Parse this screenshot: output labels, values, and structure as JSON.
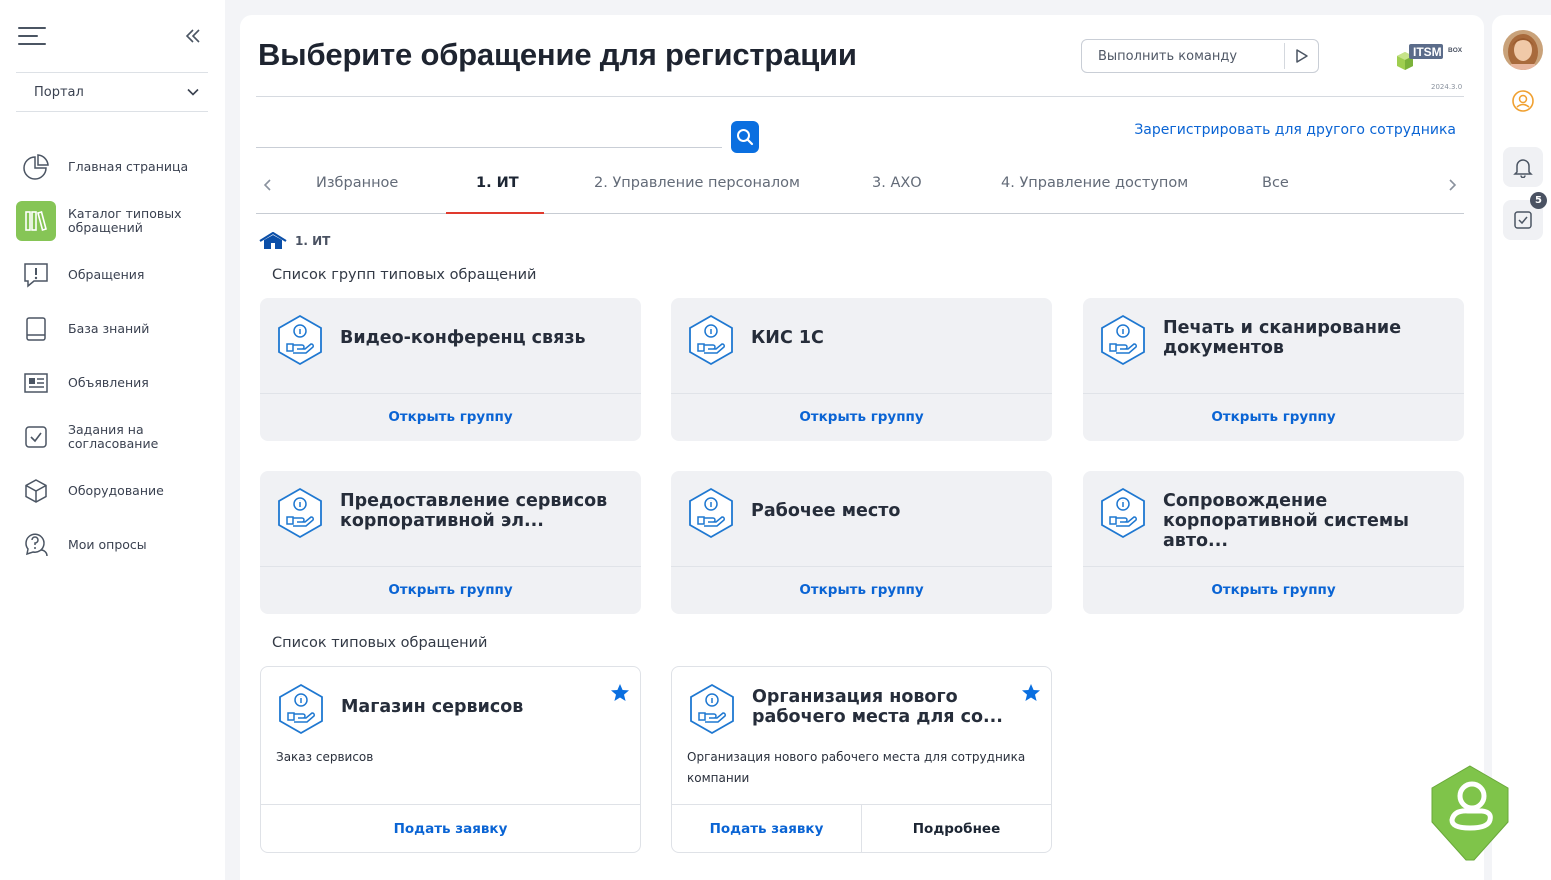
{
  "sidebar": {
    "portal_select": "Портал",
    "items": [
      {
        "label": "Главная страница",
        "icon": "pie-chart-icon"
      },
      {
        "label": "Каталог типовых обращений",
        "icon": "catalog-books-icon",
        "active": true
      },
      {
        "label": "Обращения",
        "icon": "exclamation-message-icon"
      },
      {
        "label": "База знаний",
        "icon": "book-icon"
      },
      {
        "label": "Объявления",
        "icon": "newspaper-icon"
      },
      {
        "label": "Задания на согласование",
        "icon": "checkbox-icon"
      },
      {
        "label": "Оборудование",
        "icon": "cube-icon"
      },
      {
        "label": "Мои опросы",
        "icon": "question-bubble-icon"
      }
    ]
  },
  "header": {
    "title": "Выберите обращение для регистрации",
    "command_placeholder": "Выполнить команду",
    "logo_text": "ITSM",
    "logo_sub": "BOX",
    "version": "2024.3.0"
  },
  "search": {
    "value": "",
    "other_employee_link": "Зарегистрировать для другого сотрудника"
  },
  "tabs": [
    {
      "label": "Избранное"
    },
    {
      "label": "1. ИТ",
      "active": true
    },
    {
      "label": "2. Управление персоналом"
    },
    {
      "label": "3. АХО"
    },
    {
      "label": "4. Управление доступом"
    },
    {
      "label": "Все"
    }
  ],
  "breadcrumb": "1. ИТ",
  "groups_section": {
    "title": "Список групп типовых обращений",
    "link_label": "Открыть группу",
    "cards": [
      {
        "title": "Видео-конференц связь"
      },
      {
        "title": "КИС 1С"
      },
      {
        "title": "Печать и сканирование документов"
      },
      {
        "title": "Предоставление сервисов корпоративной эл..."
      },
      {
        "title": "Рабочее место"
      },
      {
        "title": "Сопровождение корпоративной системы авто..."
      }
    ]
  },
  "requests_section": {
    "title": "Список типовых обращений",
    "submit_label": "Подать заявку",
    "more_label": "Подробнее",
    "items": [
      {
        "title": "Магазин сервисов",
        "description": "Заказ сервисов"
      },
      {
        "title": "Организация нового рабочего места для со...",
        "description": "Организация нового рабочего места для сотрудника компании"
      }
    ]
  },
  "rail": {
    "tasks_badge": "5"
  },
  "colors": {
    "accent_blue": "#0a6fe0",
    "active_green": "#86c556",
    "tab_underline": "#e03a2e",
    "assistant_green": "#7fc44a"
  }
}
